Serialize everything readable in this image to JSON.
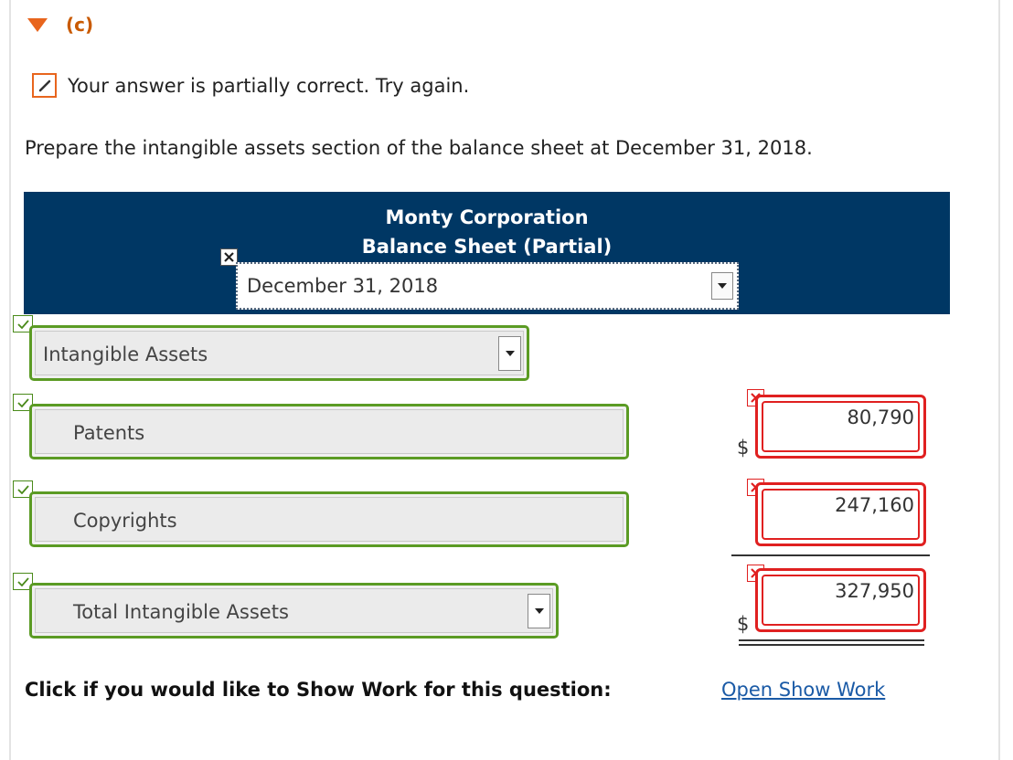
{
  "section": {
    "label": "(c)"
  },
  "status": {
    "message": "Your answer is partially correct.  Try again."
  },
  "instruction": "Prepare the intangible assets section of the balance sheet at December 31, 2018.",
  "header": {
    "company": "Monty Corporation",
    "statement": "Balance Sheet (Partial)",
    "date_value": "December 31, 2018"
  },
  "rows": [
    {
      "label": "Intangible Assets"
    },
    {
      "label": "Patents",
      "amount": "80,790",
      "currency": "$"
    },
    {
      "label": "Copyrights",
      "amount": "247,160"
    },
    {
      "label": "Total Intangible Assets",
      "amount": "327,950",
      "currency": "$"
    }
  ],
  "show_work": {
    "prompt": "Click if you would like to Show Work for this question:",
    "link": "Open Show Work"
  },
  "colors": {
    "header_bg": "#003764",
    "correct": "#5b9b24",
    "incorrect": "#e02020",
    "accent": "#e8651d",
    "link": "#1a5aa6"
  }
}
